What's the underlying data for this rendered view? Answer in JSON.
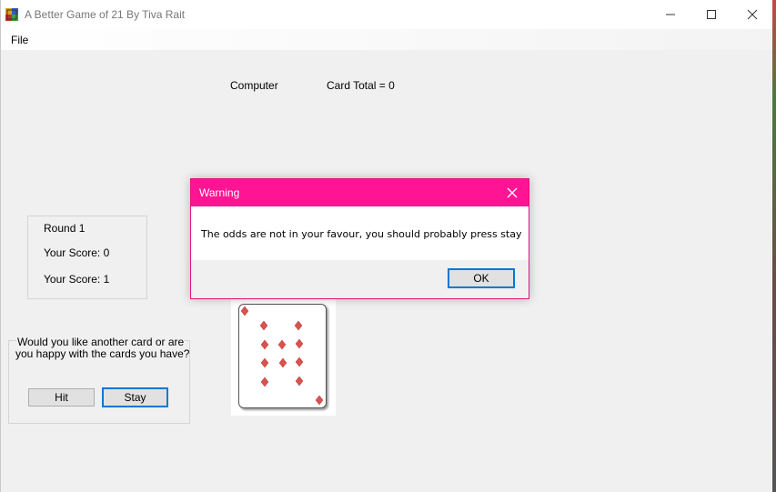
{
  "window": {
    "title": "A Better Game of 21 By Tiva Rait",
    "icons": {
      "app": "cards-app-icon",
      "minimize": "minimize-icon",
      "maximize": "maximize-icon",
      "close": "close-icon"
    }
  },
  "menu": {
    "items": [
      "File"
    ]
  },
  "computer": {
    "label": "Computer",
    "card_total": "Card Total = 0"
  },
  "scoreboard": {
    "round": "Round 1",
    "score_1": "Your Score: 0",
    "score_2": "Your Score: 1"
  },
  "prompt": {
    "line1": "Would you like another card or are",
    "line2": "you happy with the cards you have?",
    "hit": "Hit",
    "stay": "Stay"
  },
  "card": {
    "rank": "9",
    "suit": "diamonds",
    "suit_color": "#d9534f"
  },
  "dialog": {
    "title": "Warning",
    "message": "The odds are not in your favour, you should probably press stay",
    "ok": "OK",
    "title_color": "#ff1493",
    "border_color": "#e2127f"
  },
  "colors": {
    "accent": "#0078d7",
    "window_bg": "#f0f0f0"
  }
}
